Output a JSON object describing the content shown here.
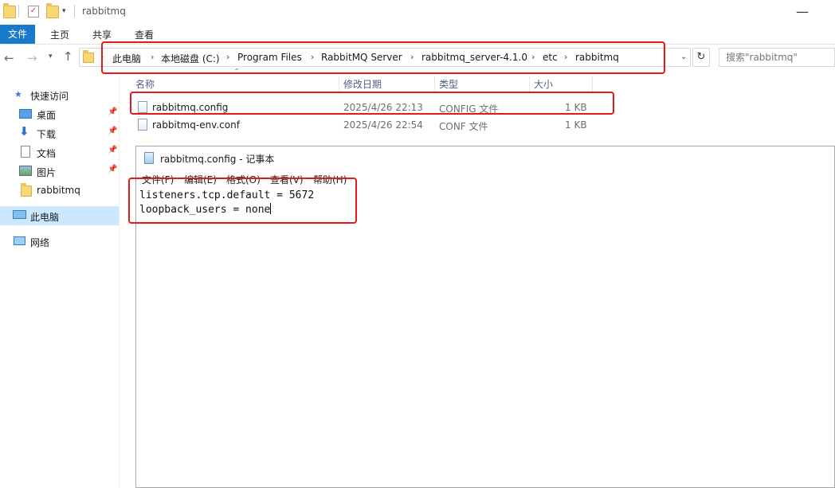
{
  "window": {
    "title": "rabbitmq"
  },
  "ribbon": {
    "file": "文件",
    "tabs": [
      "主页",
      "共享",
      "查看"
    ]
  },
  "address": {
    "crumbs": [
      "此电脑",
      "本地磁盘 (C:)",
      "Program Files",
      "RabbitMQ Server",
      "rabbitmq_server-4.1.0",
      "etc",
      "rabbitmq"
    ]
  },
  "search": {
    "placeholder": "搜索\"rabbitmq\""
  },
  "sidebar": {
    "quick_access": "快速访问",
    "items": [
      {
        "label": "桌面",
        "icon": "desktop-icon",
        "pinned": true
      },
      {
        "label": "下载",
        "icon": "download-icon",
        "pinned": true
      },
      {
        "label": "文档",
        "icon": "document-icon",
        "pinned": true
      },
      {
        "label": "图片",
        "icon": "picture-icon",
        "pinned": true
      },
      {
        "label": "rabbitmq",
        "icon": "folder-icon",
        "pinned": false
      }
    ],
    "this_pc": "此电脑",
    "network": "网络"
  },
  "list": {
    "columns": [
      "名称",
      "修改日期",
      "类型",
      "大小"
    ],
    "rows": [
      {
        "name": "rabbitmq.config",
        "date": "2025/4/26 22:13",
        "type": "CONFIG 文件",
        "size": "1 KB"
      },
      {
        "name": "rabbitmq-env.conf",
        "date": "2025/4/26 22:54",
        "type": "CONF 文件",
        "size": "1 KB"
      }
    ]
  },
  "notepad": {
    "title": "rabbitmq.config - 记事本",
    "menu": [
      "文件(F)",
      "编辑(E)",
      "格式(O)",
      "查看(V)",
      "帮助(H)"
    ],
    "lines": [
      "listeners.tcp.default = 5672",
      "loopback_users = none"
    ]
  },
  "colors": {
    "accent": "#1979ca",
    "highlight": "#e81919",
    "selected": "#cce8ff"
  }
}
